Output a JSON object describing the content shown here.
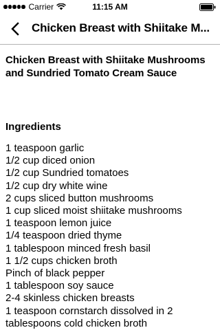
{
  "status_bar": {
    "carrier": "Carrier",
    "time": "11:15 AM",
    "signal_icon": "signal-dots-icon",
    "wifi_icon": "wifi-icon",
    "battery_icon": "battery-icon"
  },
  "nav": {
    "back_icon": "chevron-left-icon",
    "title": "Chicken Breast with Shiitake M..."
  },
  "recipe": {
    "title": "Chicken Breast with Shiitake Mushrooms and Sundried Tomato Cream Sauce",
    "ingredients_heading": "Ingredients",
    "ingredients": [
      "1 teaspoon garlic",
      "1/2 cup diced onion",
      "1/2 cup Sundried tomatoes",
      "1/2 cup dry white wine",
      "2 cups sliced button mushrooms",
      "1 cup sliced moist shiitake mushrooms",
      "1 teaspoon lemon juice",
      "1/4 teaspoon dried thyme",
      "1 tablespoon minced fresh basil",
      "1 1/2 cups chicken broth",
      "Pinch of black pepper",
      "1 tablespoon soy sauce",
      "2-4 skinless chicken breasts",
      "1 teaspoon cornstarch dissolved in 2",
      "tablespoons cold chicken broth"
    ]
  }
}
